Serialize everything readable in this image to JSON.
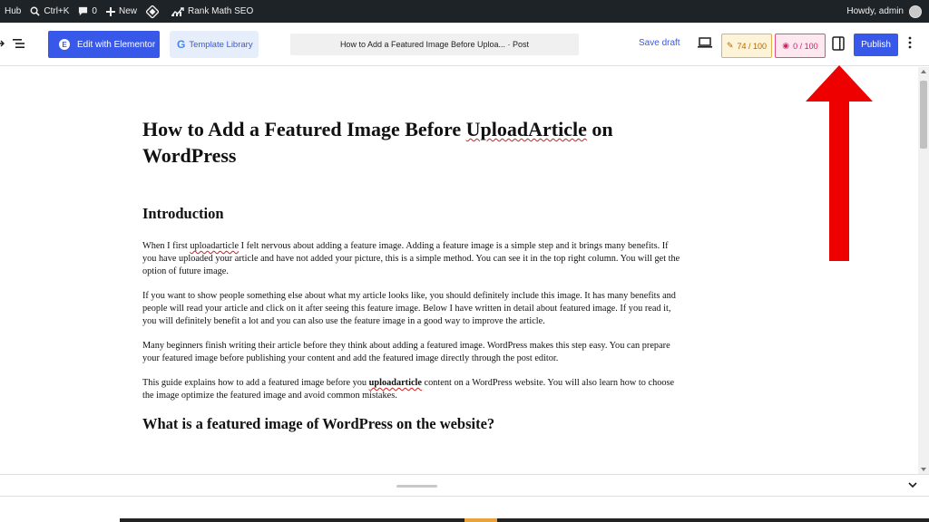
{
  "admin_bar": {
    "hub_label": "Hub",
    "search_shortcut": "Ctrl+K",
    "comments_count": "0",
    "new_label": "New",
    "rank_math_label": "Rank Math SEO",
    "greeting": "Howdy, admin"
  },
  "header": {
    "elementor_label": "Edit with Elementor",
    "template_library_label": "Template Library",
    "document_title": "How to Add a Featured Image Before Uploa... · Post",
    "save_draft_label": "Save draft",
    "seo_score": "74 / 100",
    "content_ai_score": "0 / 100",
    "publish_label": "Publish"
  },
  "post": {
    "title_parts": [
      "How to Add a Featured Image Before ",
      "UploadArticle",
      " on WordPress"
    ],
    "intro_heading": "Introduction",
    "p1_parts": [
      "When I first ",
      "uploadarticle",
      " I felt nervous about adding a feature image. Adding a feature image is a simple step and it brings many benefits. If you have uploaded your article and have not added your picture, this is a simple method. You can see it in the top right column. You will get the option of future image."
    ],
    "p2": "If you want to show people something else about what my article looks like, you should definitely include this image. It has many benefits and people will read your article and click on it after seeing this feature image. Below I have written in detail about featured image. If you read it, you will definitely benefit a lot and you can also use the feature image in a good way to improve the article.",
    "p3": "Many beginners finish writing their article before they think about adding a featured image. WordPress makes this step easy. You can prepare your featured image before publishing your content and add the featured image directly through the post editor.",
    "p4_parts": [
      "This guide explains how to add a featured image before you ",
      "uploadarticle",
      " content on a WordPress website. You will also learn how to choose the image optimize the featured image and avoid common mistakes."
    ],
    "next_heading": "What is a featured image of WordPress on the website?"
  },
  "colors": {
    "admin_bar_bg": "#1d2327",
    "accent_blue": "#3858e9",
    "annotation_red": "#ee0000",
    "seo_orange": "#e4b24a",
    "content_ai_pink": "#e24c80"
  },
  "icons": [
    "search-icon",
    "comment-icon",
    "plus-icon",
    "diamond-logo-icon",
    "rank-math-icon",
    "list-view-icon",
    "elementor-icon",
    "google-g-icon",
    "desktop-preview-icon",
    "seo-score-icon",
    "content-ai-icon",
    "sidebar-toggle-icon",
    "kebab-menu-icon",
    "chevron-down-icon",
    "red-arrow-annotation"
  ]
}
